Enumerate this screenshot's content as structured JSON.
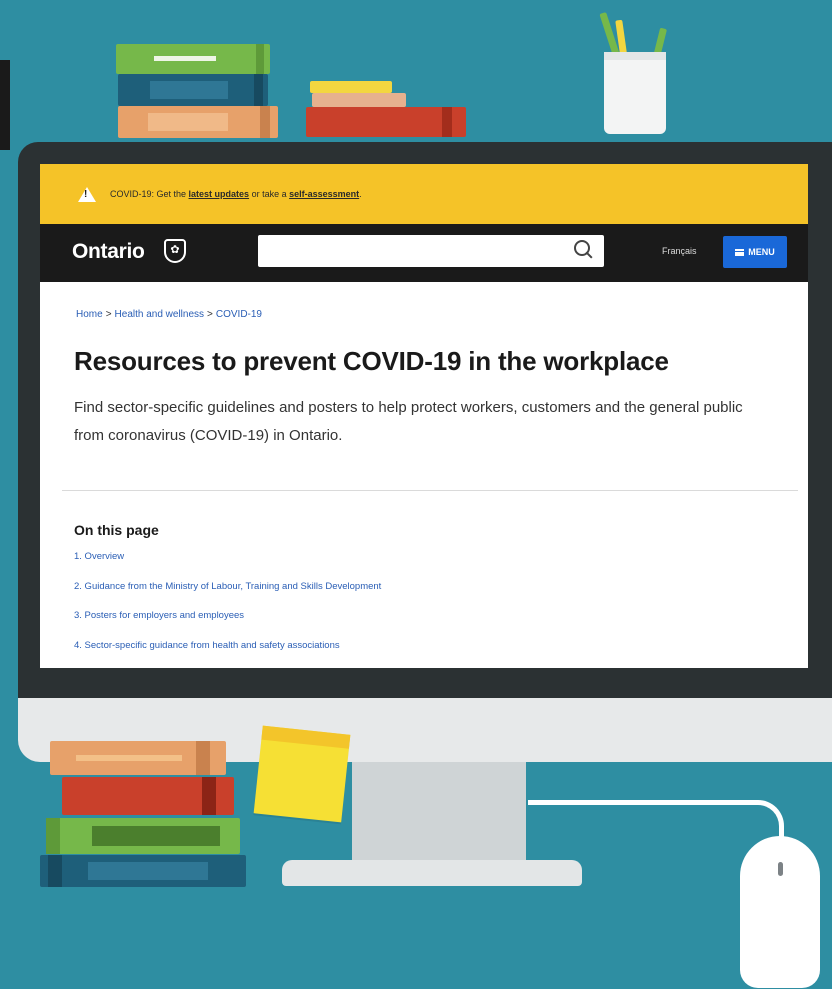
{
  "alert": {
    "prefix": "COVID-19: Get the ",
    "link1": "latest updates",
    "middle": " or take a ",
    "link2": "self-assessment",
    "suffix": "."
  },
  "header": {
    "logo_text": "Ontario",
    "search_placeholder": "",
    "language_link": "Français",
    "menu_label": "MENU"
  },
  "breadcrumb": {
    "items": [
      "Home",
      "Health and wellness",
      "COVID-19"
    ],
    "separator": ">"
  },
  "page": {
    "title": "Resources to prevent COVID-19 in the workplace",
    "lead": "Find sector-specific guidelines and posters to help protect workers, customers and the general public from coronavirus (COVID-19) in Ontario."
  },
  "on_this_page": {
    "heading": "On this page",
    "items": [
      "1. Overview",
      "2. Guidance from the Ministry of Labour, Training and Skills Development",
      "3. Posters for employers and employees",
      "4. Sector-specific guidance from health and safety associations"
    ]
  },
  "colors": {
    "background": "#2e8ea2",
    "alert_bar": "#f5c328",
    "header": "#1a1a1a",
    "menu_button": "#1a68d8",
    "link": "#2a5eb5"
  },
  "icons": [
    "warning-icon",
    "trillium-logo-icon",
    "search-icon",
    "menu-icon"
  ]
}
